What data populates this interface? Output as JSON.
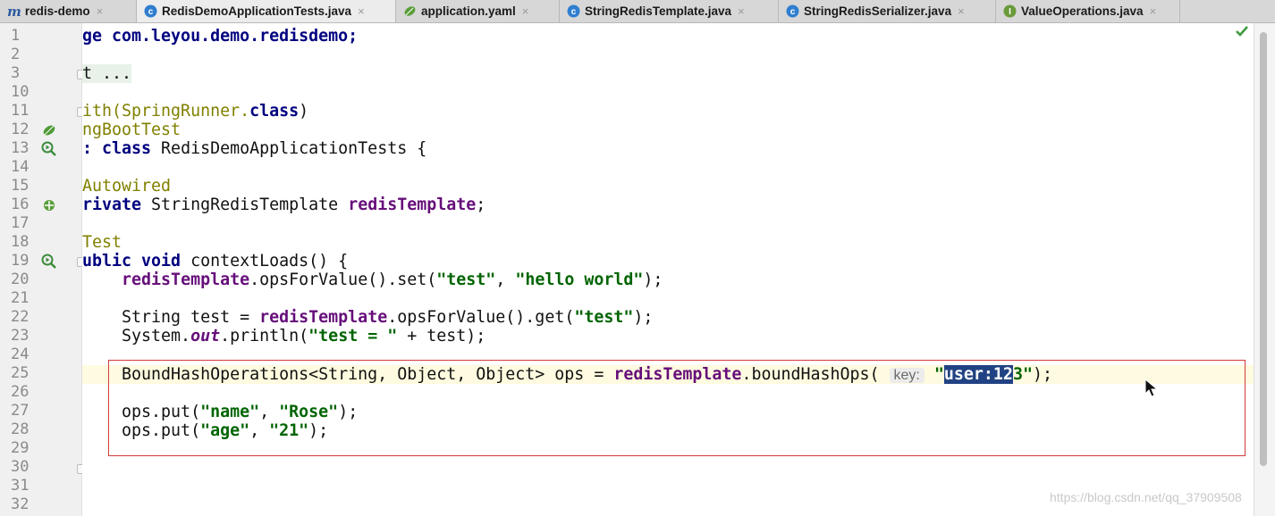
{
  "tabs": [
    {
      "label": "redis-demo",
      "icon": "module-m-icon",
      "closable": true
    },
    {
      "label": "RedisDemoApplicationTests.java",
      "icon": "class-icon",
      "closable": true,
      "active": true
    },
    {
      "label": "application.yaml",
      "icon": "spring-leaf-icon",
      "closable": true
    },
    {
      "label": "StringRedisTemplate.java",
      "icon": "class-icon",
      "closable": true
    },
    {
      "label": "StringRedisSerializer.java",
      "icon": "class-icon",
      "closable": true
    },
    {
      "label": "ValueOperations.java",
      "icon": "interface-icon",
      "closable": true
    }
  ],
  "close_glyph": "×",
  "line_numbers": [
    "1",
    "2",
    "3",
    "10",
    "11",
    "12",
    "13",
    "14",
    "15",
    "16",
    "17",
    "18",
    "19",
    "20",
    "21",
    "22",
    "23",
    "24",
    "25",
    "26",
    "27",
    "28",
    "29",
    "30",
    "31",
    "32"
  ],
  "code": {
    "l1": {
      "a": "ge com.leyou.demo.redisdemo;"
    },
    "l3": {
      "a": "t ..."
    },
    "l11": {
      "a": "ith(SpringRunner.",
      "b": "class",
      "c": ")"
    },
    "l12": {
      "a": "ngBootTest"
    },
    "l13": {
      "a": ": ",
      "b": "class",
      "c": " RedisDemoApplicationTests {"
    },
    "l15": {
      "a": "Autowired"
    },
    "l16": {
      "a": "rivate",
      "b": " StringRedisTemplate ",
      "c": "redisTemplate",
      "d": ";"
    },
    "l18": {
      "a": "Test"
    },
    "l19": {
      "a": "ublic void",
      "b": " contextLoads() {"
    },
    "l20": {
      "a": "    ",
      "b": "redisTemplate",
      "c": ".opsForValue().set(",
      "d": "\"test\"",
      "e": ", ",
      "f": "\"hello world\"",
      "g": ");"
    },
    "l22": {
      "a": "    String test = ",
      "b": "redisTemplate",
      "c": ".opsForValue().get(",
      "d": "\"test\"",
      "e": ");"
    },
    "l23": {
      "a": "    System.",
      "b": "out",
      "c": ".println(",
      "d": "\"test = \"",
      "e": " + test);"
    },
    "l25": {
      "a": "    BoundHashOperations<String, Object, Object> ops = ",
      "b": "redisTemplate",
      "c": ".boundHashOps( ",
      "hint": "key:",
      "d": " \"",
      "sel": "user:12",
      "e": "3\"",
      "f": ");"
    },
    "l27": {
      "a": "    ops.put(",
      "b": "\"name\"",
      "c": ", ",
      "d": "\"Rose\"",
      "e": ");"
    },
    "l28": {
      "a": "    ops.put(",
      "b": "\"age\"",
      "c": ", ",
      "d": "\"21\"",
      "e": ");"
    }
  },
  "watermark": "https://blog.csdn.net/qq_37909508",
  "status_check_icon": "checkmark-icon",
  "colors": {
    "keyword": "#000080",
    "string": "#006400",
    "field": "#660e7a",
    "annotation_box": "#d23a3a",
    "selection": "#214283"
  }
}
